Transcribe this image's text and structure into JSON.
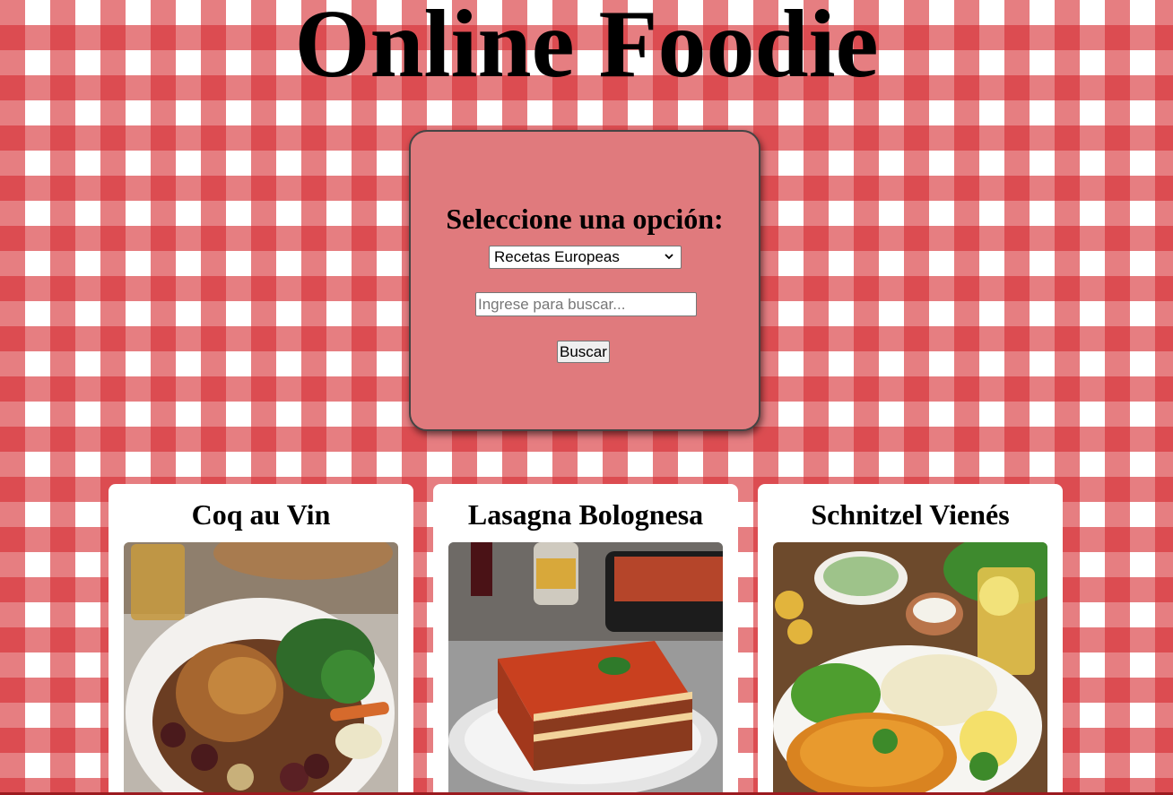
{
  "header": {
    "title": "Online Foodie"
  },
  "search_panel": {
    "heading": "Seleccione una opción:",
    "category_select": {
      "selected": "Recetas Europeas"
    },
    "search_input": {
      "value": "",
      "placeholder": "Ingrese para buscar..."
    },
    "search_button_label": "Buscar"
  },
  "recipes": [
    {
      "title": "Coq au Vin",
      "image_icon": "roast-chicken-plate-image"
    },
    {
      "title": "Lasagna Bolognesa",
      "image_icon": "lasagna-plate-image"
    },
    {
      "title": "Schnitzel Vienés",
      "image_icon": "schnitzel-plate-image"
    }
  ],
  "colors": {
    "tablecloth_red": "#d62e34",
    "panel_background": "#e07a7d",
    "card_background": "#ffffff"
  }
}
